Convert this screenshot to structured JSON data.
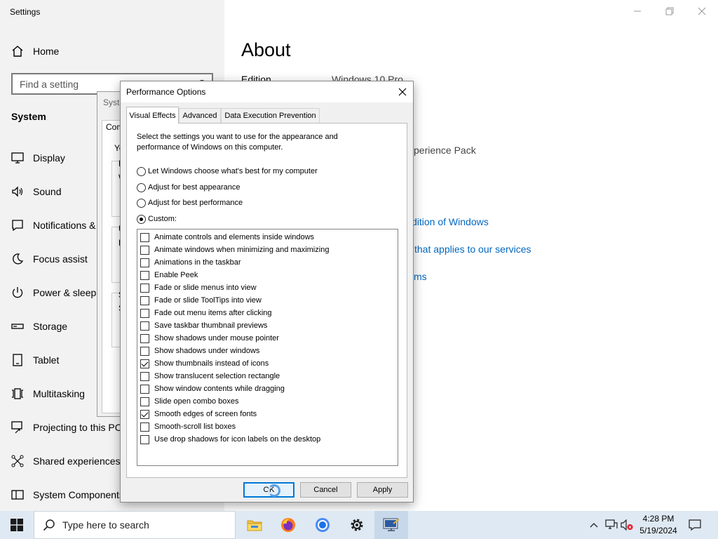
{
  "settings": {
    "app_title": "Settings",
    "search_placeholder": "Find a setting",
    "section": "System",
    "home": "Home",
    "nav": [
      {
        "label": "Display",
        "icon": "display-icon"
      },
      {
        "label": "Sound",
        "icon": "sound-icon"
      },
      {
        "label": "Notifications &",
        "icon": "notifications-icon"
      },
      {
        "label": "Focus assist",
        "icon": "focus-assist-icon"
      },
      {
        "label": "Power & sleep",
        "icon": "power-icon"
      },
      {
        "label": "Storage",
        "icon": "storage-icon"
      },
      {
        "label": "Tablet",
        "icon": "tablet-icon"
      },
      {
        "label": "Multitasking",
        "icon": "multitasking-icon"
      },
      {
        "label": "Projecting to this PC",
        "icon": "projecting-icon"
      },
      {
        "label": "Shared experiences",
        "icon": "shared-experiences-icon"
      },
      {
        "label": "System Components",
        "icon": "system-components-icon"
      }
    ],
    "main": {
      "title": "About",
      "edition_label": "Edition",
      "edition_value": "Windows 10 Pro",
      "experience_pack": "xperience Pack",
      "link_edition": "dition of Windows",
      "link_services": "that applies to our services",
      "link_terms": "ms"
    }
  },
  "system_properties": {
    "title": "Syste",
    "tab": "Com",
    "letters": [
      "Yo",
      "P",
      "W",
      "U",
      "D",
      "S",
      "S"
    ]
  },
  "perf_dialog": {
    "title": "Performance Options",
    "tabs": [
      "Visual Effects",
      "Advanced",
      "Data Execution Prevention"
    ],
    "active_tab": 0,
    "description": "Select the settings you want to use for the appearance and performance of Windows on this computer.",
    "radios": [
      {
        "label": "Let Windows choose what's best for my computer",
        "checked": false
      },
      {
        "label": "Adjust for best appearance",
        "checked": false
      },
      {
        "label": "Adjust for best performance",
        "checked": false
      },
      {
        "label": "Custom:",
        "checked": true
      }
    ],
    "options": [
      {
        "label": "Animate controls and elements inside windows",
        "checked": false
      },
      {
        "label": "Animate windows when minimizing and maximizing",
        "checked": false
      },
      {
        "label": "Animations in the taskbar",
        "checked": false
      },
      {
        "label": "Enable Peek",
        "checked": false
      },
      {
        "label": "Fade or slide menus into view",
        "checked": false
      },
      {
        "label": "Fade or slide ToolTips into view",
        "checked": false
      },
      {
        "label": "Fade out menu items after clicking",
        "checked": false
      },
      {
        "label": "Save taskbar thumbnail previews",
        "checked": false
      },
      {
        "label": "Show shadows under mouse pointer",
        "checked": false
      },
      {
        "label": "Show shadows under windows",
        "checked": false
      },
      {
        "label": "Show thumbnails instead of icons",
        "checked": true
      },
      {
        "label": "Show translucent selection rectangle",
        "checked": false
      },
      {
        "label": "Show window contents while dragging",
        "checked": false
      },
      {
        "label": "Slide open combo boxes",
        "checked": false
      },
      {
        "label": "Smooth edges of screen fonts",
        "checked": true
      },
      {
        "label": "Smooth-scroll list boxes",
        "checked": false
      },
      {
        "label": "Use drop shadows for icon labels on the desktop",
        "checked": false
      }
    ],
    "buttons": {
      "ok": "OK",
      "cancel": "Cancel",
      "apply": "Apply"
    }
  },
  "taskbar": {
    "search_placeholder": "Type here to search",
    "apps": [
      "file-explorer-icon",
      "firefox-icon",
      "chrome-icon",
      "settings-icon",
      "system-properties-icon"
    ],
    "time": "4:28 PM",
    "date": "5/19/2024"
  }
}
